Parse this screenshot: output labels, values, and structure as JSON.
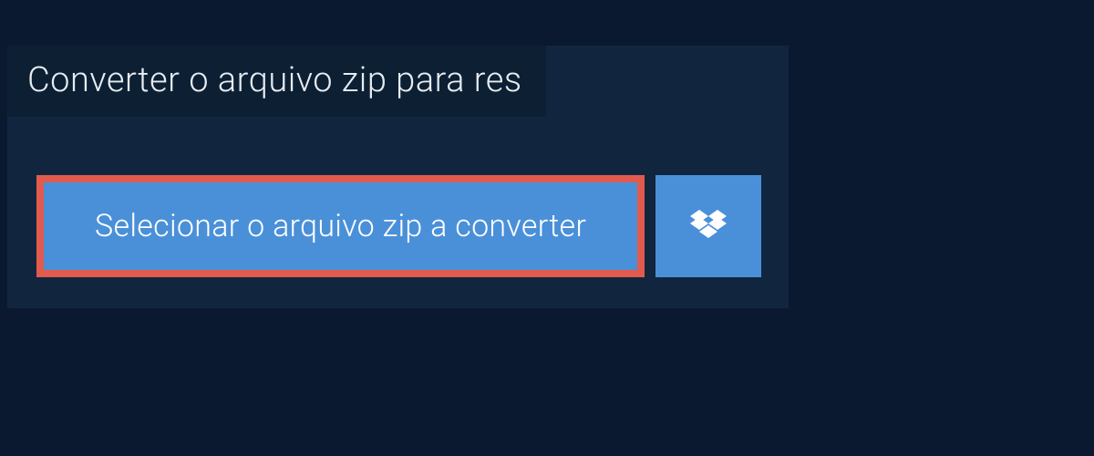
{
  "title": "Converter o arquivo zip para res",
  "select_button_label": "Selecionar o arquivo zip a converter",
  "colors": {
    "background": "#0a192f",
    "panel": "#11263e",
    "title_bar": "#0d2033",
    "button": "#4a90d9",
    "button_border": "#e15a4e",
    "text_light": "#e8ecf2",
    "text_white": "#ffffff"
  }
}
